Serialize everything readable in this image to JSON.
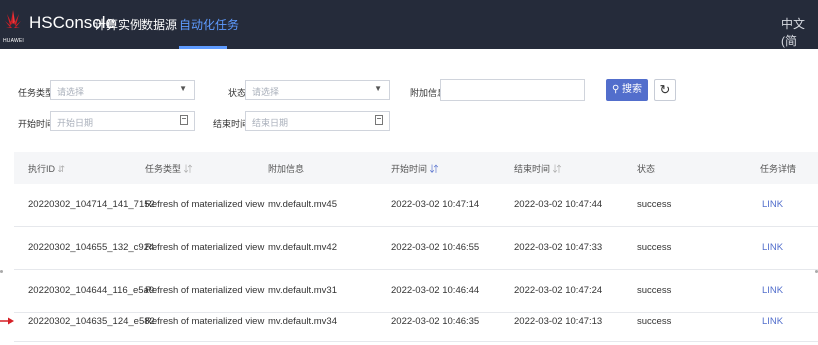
{
  "header": {
    "brand": "HSConsole",
    "logo_text": "HUAWEI",
    "nav": [
      "计算实例",
      "数据源",
      "自动化任务"
    ],
    "active_nav": "自动化任务",
    "lang": "中文 (简"
  },
  "filters": {
    "task_type_label": "任务类型",
    "task_type_placeholder": "请选择",
    "status_label": "状态",
    "status_placeholder": "请选择",
    "extra_info_label": "附加信息",
    "start_time_label": "开始时间",
    "start_time_placeholder": "开始日期",
    "end_time_label": "结束时间",
    "end_time_placeholder": "结束日期",
    "search_button": "搜索"
  },
  "table": {
    "headers": [
      "执行ID",
      "任务类型",
      "附加信息",
      "开始时间",
      "结束时间",
      "状态",
      "任务详情"
    ],
    "rows": [
      [
        "20220302_104714_141_7152",
        "Refresh of materialized view",
        "mv.default.mv45",
        "2022-03-02 10:47:14",
        "2022-03-02 10:47:44",
        "success",
        "LINK"
      ],
      [
        "20220302_104655_132_c924",
        "Refresh of materialized view",
        "mv.default.mv42",
        "2022-03-02 10:46:55",
        "2022-03-02 10:47:33",
        "success",
        "LINK"
      ],
      [
        "20220302_104644_116_e5a9",
        "Refresh of materialized view",
        "mv.default.mv31",
        "2022-03-02 10:46:44",
        "2022-03-02 10:47:24",
        "success",
        "LINK"
      ],
      [
        "20220302_104635_124_e582",
        "Refresh of materialized view",
        "mv.default.mv34",
        "2022-03-02 10:46:35",
        "2022-03-02 10:47:13",
        "success",
        "LINK"
      ]
    ]
  },
  "colors": {
    "topbar": "#252b3a",
    "accent": "#526ecc",
    "logo_red": "#d61f26"
  },
  "icons": [
    "huawei-logo",
    "chevron-down-icon",
    "calendar-icon",
    "search-icon",
    "refresh-icon",
    "sort-icon"
  ]
}
